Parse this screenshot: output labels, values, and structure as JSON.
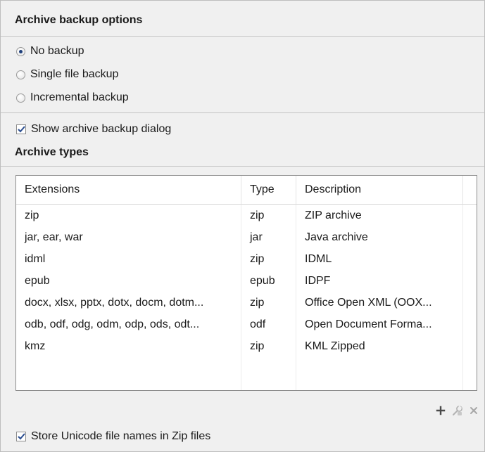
{
  "archive_backup": {
    "title": "Archive backup options",
    "options": [
      {
        "label": "No backup",
        "selected": true
      },
      {
        "label": "Single file backup",
        "selected": false
      },
      {
        "label": "Incremental backup",
        "selected": false
      }
    ],
    "show_dialog": {
      "label": "Show archive backup dialog",
      "checked": true
    }
  },
  "archive_types": {
    "title": "Archive types",
    "columns": [
      "Extensions",
      "Type",
      "Description"
    ],
    "rows": [
      {
        "extensions": "zip",
        "type": "zip",
        "description": "ZIP archive"
      },
      {
        "extensions": "jar, ear, war",
        "type": "jar",
        "description": "Java archive"
      },
      {
        "extensions": "idml",
        "type": "zip",
        "description": "IDML"
      },
      {
        "extensions": "epub",
        "type": "epub",
        "description": "IDPF"
      },
      {
        "extensions": "docx, xlsx, pptx, dotx, docm, dotm...",
        "type": "zip",
        "description": "Office Open XML (OOX..."
      },
      {
        "extensions": "odb, odf, odg, odm, odp, ods, odt...",
        "type": "odf",
        "description": "Open Document Forma..."
      },
      {
        "extensions": "kmz",
        "type": "zip",
        "description": "KML Zipped"
      }
    ],
    "toolbar": {
      "add_icon": "plus-icon",
      "edit_icon": "edit-icon",
      "remove_icon": "remove-icon"
    }
  },
  "store_unicode": {
    "label": "Store Unicode file names in Zip files",
    "checked": true
  },
  "colors": {
    "panel_bg": "#f0f0f0",
    "check_mark": "#2a4d8f",
    "add_icon": "#4a4a4a",
    "disabled_icon": "#a8a8a8"
  }
}
